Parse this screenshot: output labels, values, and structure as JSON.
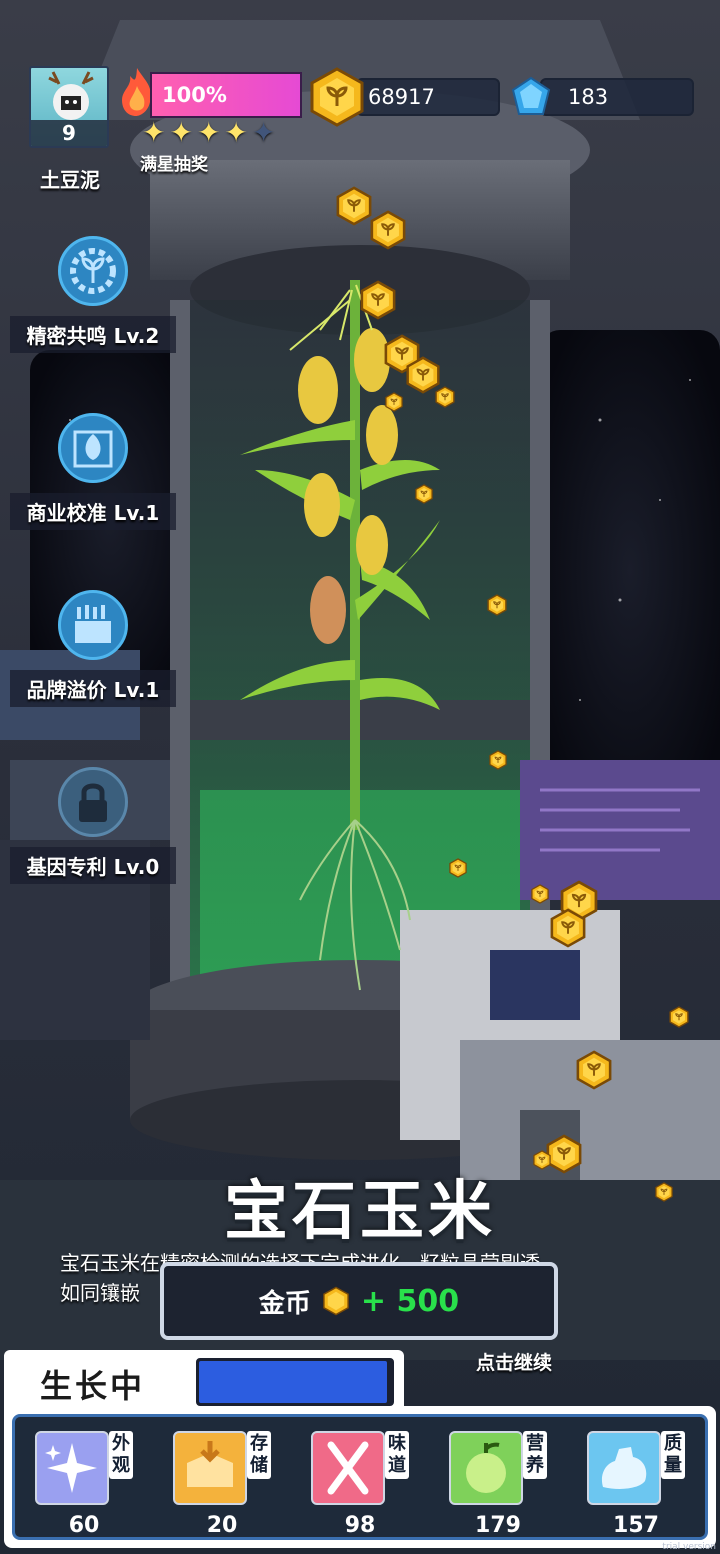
{
  "player": {
    "name": "土豆泥",
    "level": "9"
  },
  "energy": {
    "percent_label": "100%",
    "stars_filled": 4,
    "stars_total": 5,
    "draw_label": "满星抽奖"
  },
  "currency": {
    "gold": "68917",
    "gems": "183"
  },
  "skills": [
    {
      "label": "精密共鸣 Lv.2",
      "icon": "gear-plant-icon",
      "locked": false
    },
    {
      "label": "商业校准 Lv.1",
      "icon": "leaf-target-icon",
      "locked": false
    },
    {
      "label": "品牌溢价 Lv.1",
      "icon": "crate-icon",
      "locked": false
    },
    {
      "label": "基因专利 Lv.0",
      "icon": "lock-icon",
      "locked": true
    }
  ],
  "item": {
    "title": "宝石玉米",
    "description_line1": "宝石玉米在精密检测的选择下完成进化，籽粒晶莹剔透，",
    "description_line2": "如同镶嵌                                             泽。"
  },
  "reward": {
    "currency_label": "金币",
    "amount": "+ 500"
  },
  "continue_label": "点击继续",
  "growth": {
    "status_label": "生长中",
    "progress": 0.98
  },
  "attributes": [
    {
      "tag": "外观",
      "value": "60",
      "color": "#9aa0f0",
      "icon": "sparkle-icon"
    },
    {
      "tag": "存储",
      "value": "20",
      "color": "#f4b23c",
      "icon": "box-icon"
    },
    {
      "tag": "味道",
      "value": "98",
      "color": "#f06a88",
      "icon": "fork-knife-icon"
    },
    {
      "tag": "营养",
      "value": "179",
      "color": "#7fd15a",
      "icon": "fruit-icon"
    },
    {
      "tag": "质量",
      "value": "157",
      "color": "#6cc6f0",
      "icon": "muscle-icon"
    }
  ],
  "watermark": "trial version",
  "colors": {
    "accent_green": "#29e04b",
    "energy_pink": "#ff5fb0",
    "progress_blue": "#2c5de0"
  }
}
